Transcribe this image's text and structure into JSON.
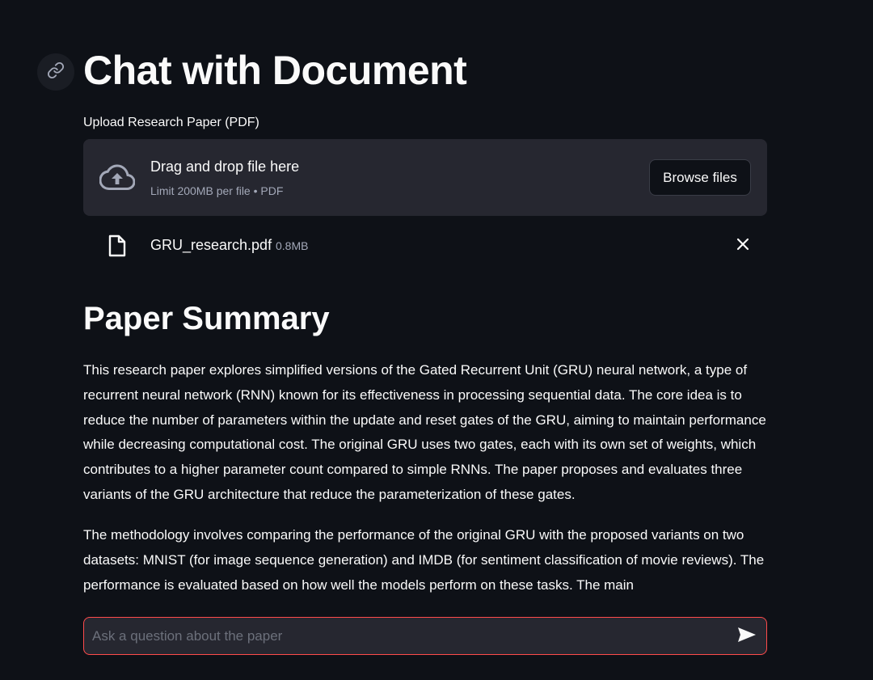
{
  "page": {
    "title": "Chat with Document",
    "anchor_icon": "link-icon"
  },
  "uploader": {
    "label": "Upload Research Paper (PDF)",
    "icon": "cloud-upload-icon",
    "drop_text": "Drag and drop file here",
    "limit_text": "Limit 200MB per file • PDF",
    "browse_label": "Browse files"
  },
  "uploaded_file": {
    "icon": "file-icon",
    "name": "GRU_research.pdf",
    "size": "0.8MB",
    "remove_icon": "close-icon"
  },
  "summary": {
    "heading": "Paper Summary",
    "paragraphs": [
      "This research paper explores simplified versions of the Gated Recurrent Unit (GRU) neural network, a type of recurrent neural network (RNN) known for its effectiveness in processing sequential data. The core idea is to reduce the number of parameters within the update and reset gates of the GRU, aiming to maintain performance while decreasing computational cost. The original GRU uses two gates, each with its own set of weights, which contributes to a higher parameter count compared to simple RNNs. The paper proposes and evaluates three variants of the GRU architecture that reduce the parameterization of these gates.",
      "The methodology involves comparing the performance of the original GRU with the proposed variants on two datasets: MNIST (for image sequence generation) and IMDB (for sentiment classification of movie reviews). The performance is evaluated based on how well the models perform on these tasks. The main"
    ]
  },
  "chat": {
    "placeholder": "Ask a question about the paper",
    "value": "",
    "send_icon": "send-icon"
  },
  "colors": {
    "background": "#0e1117",
    "surface": "#262730",
    "text": "#fafafa",
    "muted_text": "#a3a8b8",
    "focus_border": "#ff4b4b"
  }
}
